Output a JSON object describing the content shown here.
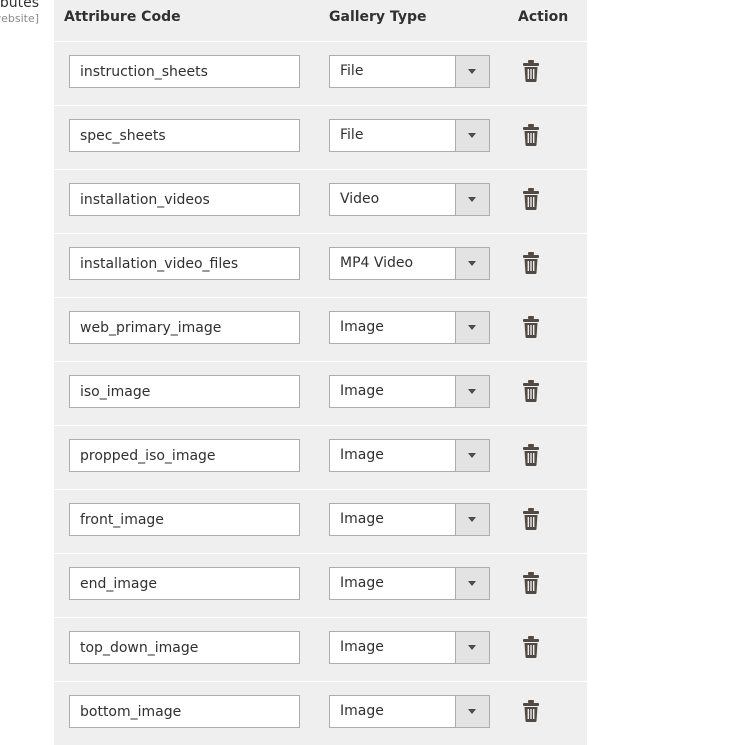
{
  "sidebar": {
    "title_fragment": "ibutes",
    "scope_fragment": "website]"
  },
  "table": {
    "headers": {
      "code": "Attribure Code",
      "type": "Gallery Type",
      "action": "Action"
    },
    "rows": [
      {
        "code": "instruction_sheets",
        "type": "File"
      },
      {
        "code": "spec_sheets",
        "type": "File"
      },
      {
        "code": "installation_videos",
        "type": "Video"
      },
      {
        "code": "installation_video_files",
        "type": "MP4 Video"
      },
      {
        "code": "web_primary_image",
        "type": "Image"
      },
      {
        "code": "iso_image",
        "type": "Image"
      },
      {
        "code": "propped_iso_image",
        "type": "Image"
      },
      {
        "code": "front_image",
        "type": "Image"
      },
      {
        "code": "end_image",
        "type": "Image"
      },
      {
        "code": "top_down_image",
        "type": "Image"
      },
      {
        "code": "bottom_image",
        "type": "Image"
      }
    ]
  },
  "icons": {
    "row_action": "trash-icon",
    "select_toggle": "chevron-down-icon"
  },
  "colors": {
    "panel_bg": "#efefef",
    "border": "#adadad",
    "select_button_bg": "#e3e3e3",
    "icon": "#514943"
  }
}
